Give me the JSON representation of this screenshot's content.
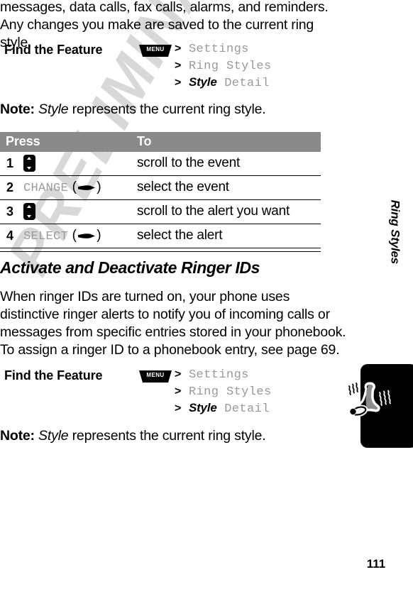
{
  "document": {
    "page_number": "111",
    "watermark": "PRELIMINARY",
    "rail_title": "Ring Styles"
  },
  "intro": {
    "paragraph": "messages, data calls, fax calls, alarms, and reminders. Any changes you make are saved to the current ring style."
  },
  "find_feature_1": {
    "label": "Find the Feature",
    "menu_key": "MENU",
    "path": [
      {
        "gt": ">",
        "text": "Settings",
        "emphasis": ""
      },
      {
        "gt": ">",
        "text": "Ring Styles",
        "emphasis": ""
      },
      {
        "gt": ">",
        "text": "Detail",
        "emphasis": "Style"
      }
    ]
  },
  "note_1": {
    "label": "Note:",
    "emphasis": "Style",
    "text": "represents the current ring style."
  },
  "table": {
    "headers": [
      "Press",
      "To"
    ],
    "rows": [
      {
        "num": "1",
        "key_type": "navkey",
        "key_label": "",
        "to": "scroll to the event"
      },
      {
        "num": "2",
        "key_type": "softkey",
        "key_label": "CHANGE",
        "to": "select the event"
      },
      {
        "num": "3",
        "key_type": "navkey",
        "key_label": "",
        "to": "scroll to the alert you want"
      },
      {
        "num": "4",
        "key_type": "softkey",
        "key_label": "SELECT",
        "to": "select the alert"
      }
    ]
  },
  "section": {
    "heading": "Activate and Deactivate Ringer IDs",
    "paragraph": "When ringer IDs are turned on, your phone uses distinctive ringer alerts to notify you of incoming calls or messages from specific entries stored in your phonebook. To assign a ringer ID to a phonebook entry, see page 69."
  },
  "find_feature_2": {
    "label": "Find the Feature",
    "menu_key": "MENU",
    "path": [
      {
        "gt": ">",
        "text": "Settings",
        "emphasis": ""
      },
      {
        "gt": ">",
        "text": "Ring Styles",
        "emphasis": ""
      },
      {
        "gt": ">",
        "text": "Detail",
        "emphasis": "Style"
      }
    ]
  },
  "note_2": {
    "label": "Note:",
    "emphasis": "Style",
    "text": "represents the current ring style."
  },
  "icons": {
    "menu_key": "menu-key-icon",
    "nav_key": "nav-up-down-key-icon",
    "soft_key_arrow": "soft-key-arrow-icon",
    "rail": "ringing-bell-icon"
  },
  "colors": {
    "text": "#000000",
    "menu_path": "#9a9a9a",
    "table_header_bg": "#8a8a8a",
    "watermark": "#d8d8d8",
    "rail_tab": "#000000"
  }
}
